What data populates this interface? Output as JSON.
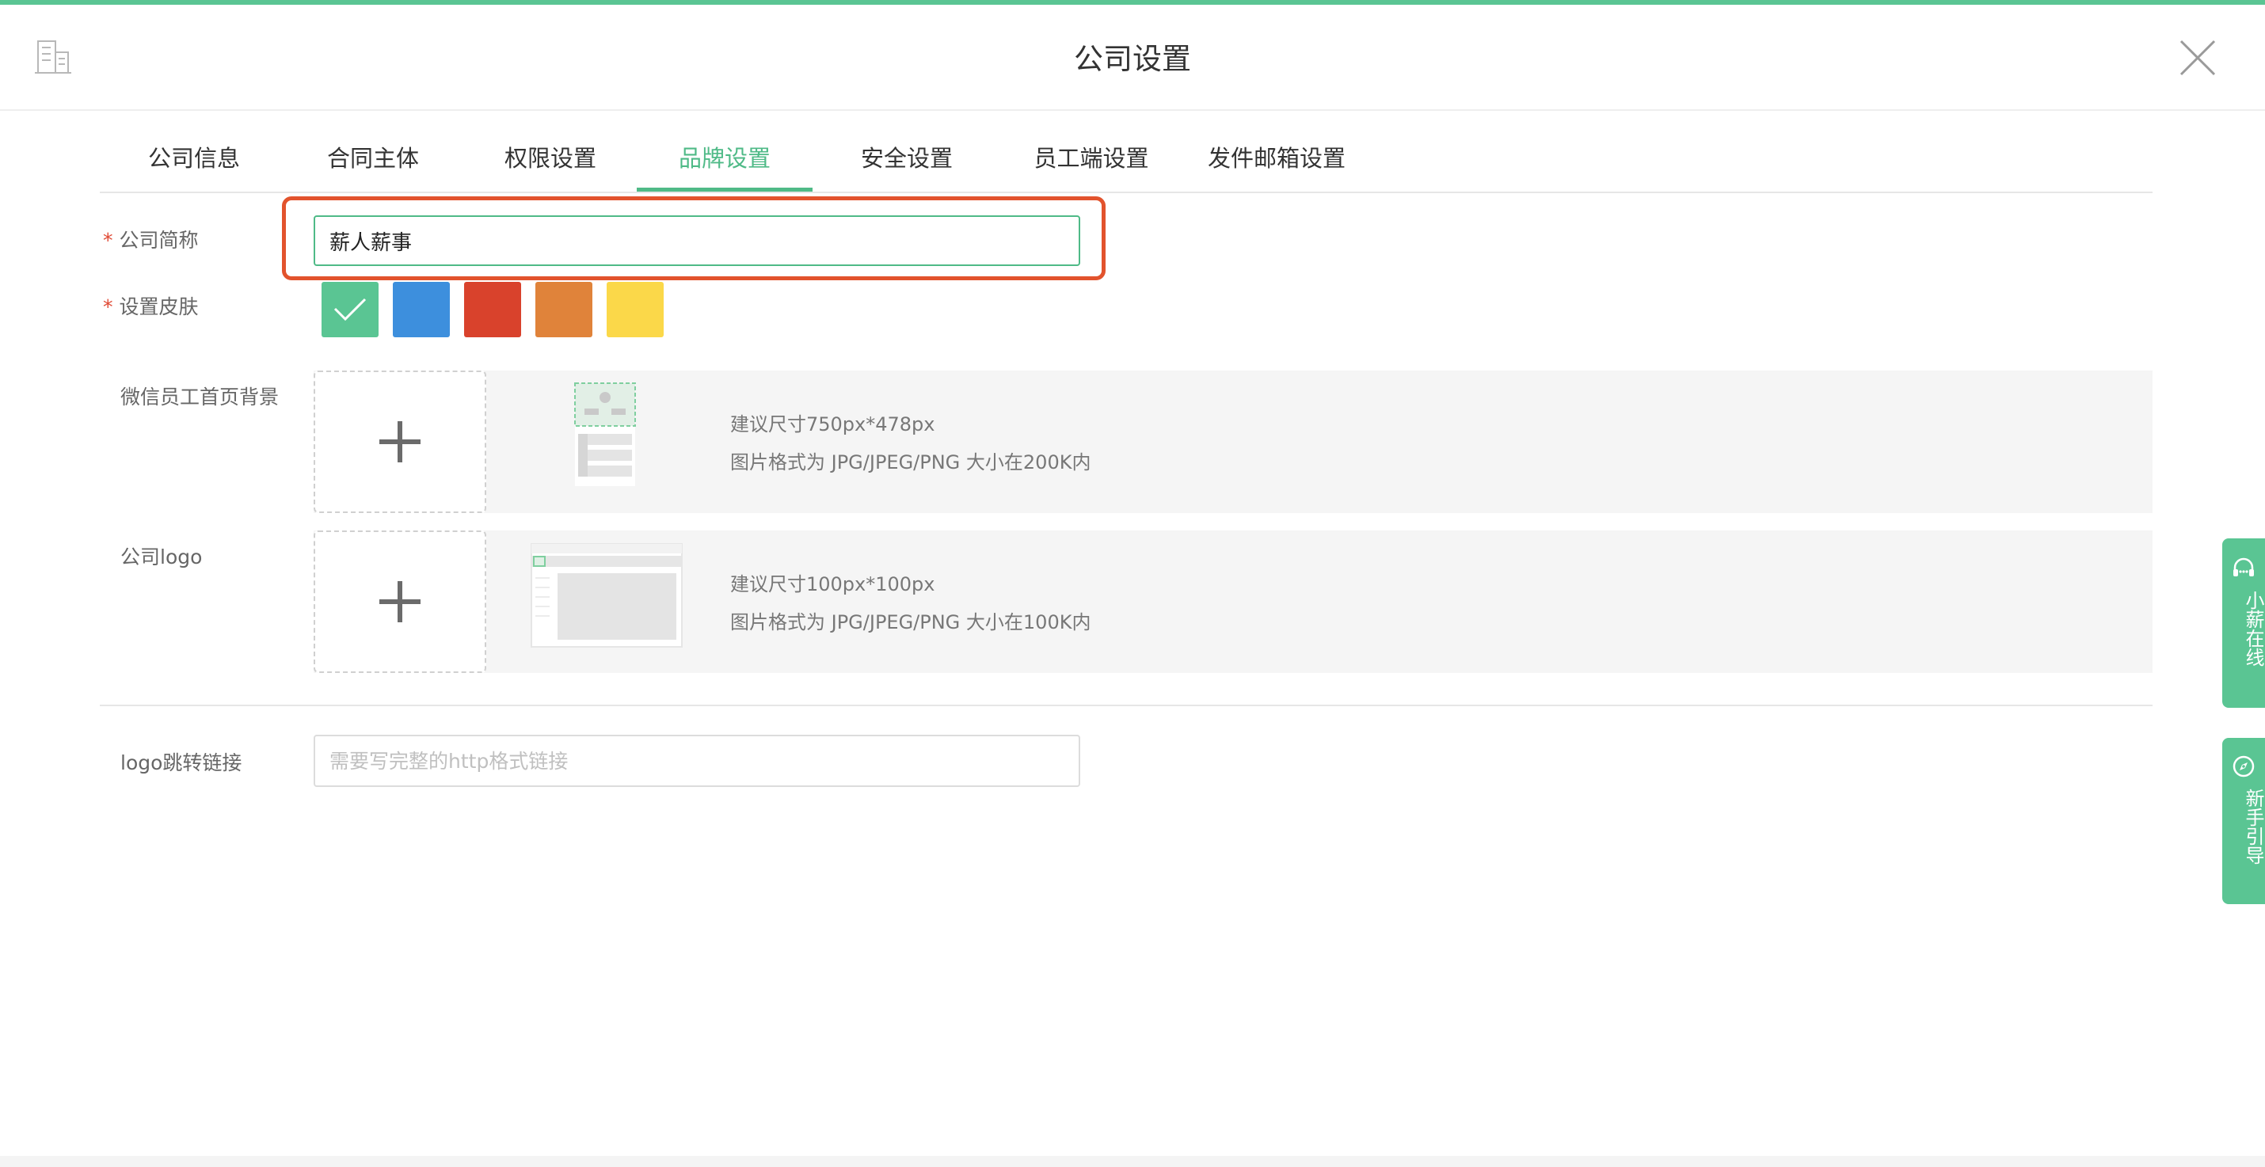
{
  "header": {
    "title": "公司设置",
    "icons": {
      "left": "building-icon",
      "close": "close-icon"
    }
  },
  "tabs": [
    {
      "label": "公司信息"
    },
    {
      "label": "合同主体"
    },
    {
      "label": "权限设置"
    },
    {
      "label": "品牌设置",
      "active": true
    },
    {
      "label": "安全设置"
    },
    {
      "label": "员工端设置"
    },
    {
      "label": "发件邮箱设置"
    }
  ],
  "form": {
    "short_name": {
      "label": "公司简称",
      "required": "*",
      "value": "薪人薪事"
    },
    "skin": {
      "label": "设置皮肤",
      "required": "*",
      "colors": [
        "#5ac593",
        "#3d8fdd",
        "#d9422c",
        "#e0833a",
        "#fbd849"
      ],
      "selected": 0
    },
    "wechat_bg": {
      "label": "微信员工首页背景",
      "hint_size": "建议尺寸750px*478px",
      "hint_format": "图片格式为 JPG/JPEG/PNG 大小在200K内"
    },
    "logo": {
      "label": "公司logo",
      "hint_size": "建议尺寸100px*100px",
      "hint_format": "图片格式为 JPG/JPEG/PNG 大小在100K内"
    },
    "logo_link": {
      "label": "logo跳转链接",
      "placeholder": "需要写完整的http格式链接",
      "value": ""
    }
  },
  "side_widgets": {
    "online": {
      "label": "小薪在线",
      "icon": "headset-icon"
    },
    "guide": {
      "label": "新手引导",
      "icon": "compass-icon"
    }
  },
  "colors": {
    "accent": "#5ac593",
    "highlight": "#e2532d"
  }
}
